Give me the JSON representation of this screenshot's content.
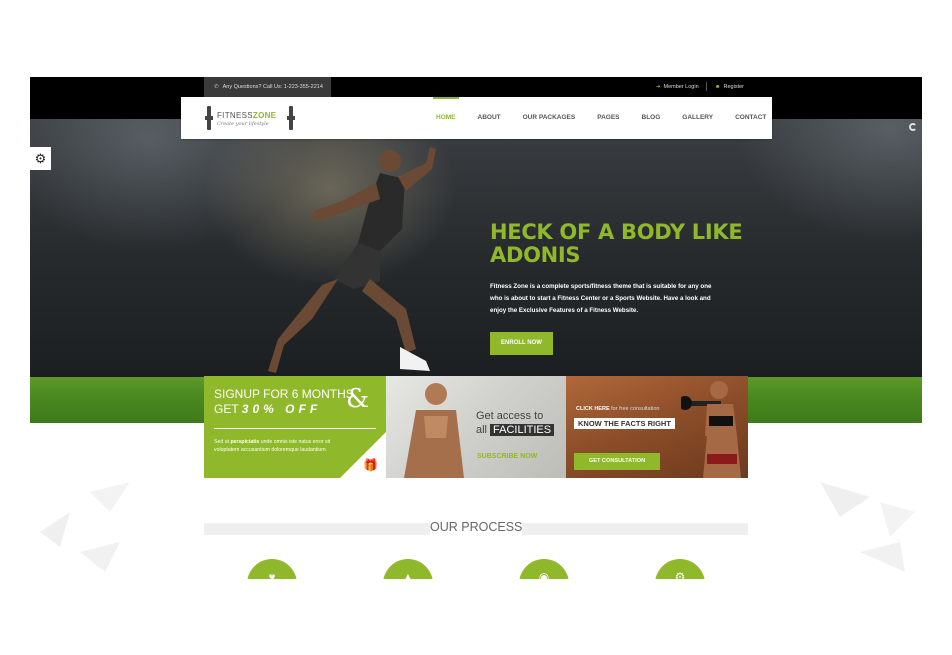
{
  "topbar": {
    "contact": "Any Questions? Call Us: 1-223-355-2214",
    "member_login": "Member Login",
    "register": "Register"
  },
  "logo": {
    "name_part1": "FITNESS",
    "name_part2": "ZONE",
    "tagline": "Create your lifestyle"
  },
  "menu": [
    "HOME",
    "ABOUT",
    "OUR PACKAGES",
    "PAGES",
    "BLOG",
    "GALLERY",
    "CONTACT"
  ],
  "menu_active": "HOME",
  "hero": {
    "title": "HECK OF A BODY LIKE ADONIS",
    "text": "Fitness Zone is a complete sports/fitness theme that is suitable for any one who is about to start a Fitness Center or a Sports Website. Have a look and enjoy the Exclusive Features of a Fitness Website.",
    "button": "ENROLL NOW"
  },
  "promo1": {
    "line1": "SIGNUP FOR 6 MONTHS",
    "line2a": "GET",
    "line2b": "30% OFF",
    "amp": "&",
    "text_pre": "Sed ut ",
    "text_bold": "perspiciatis",
    "text_post": " unde omnis iste natus error sit voluptatem accusantium doloremque laudantium."
  },
  "promo2": {
    "line1": "Get access to",
    "line2": "all",
    "highlight": "FACILITIES",
    "button": "SUBSCRIBE NOW"
  },
  "promo3": {
    "click": "CLICK HERE",
    "click_rest": "for free consultation",
    "headline": "KNOW THE FACTS RIGHT",
    "button": "GET CONSULTATION"
  },
  "process": {
    "title": "OUR PROCESS"
  },
  "colors": {
    "accent": "#8fb82a",
    "topbar": "#000000"
  },
  "icons": [
    "phone-icon",
    "login-icon",
    "user-icon",
    "gear-icon",
    "spinner-icon",
    "gift-icon"
  ]
}
